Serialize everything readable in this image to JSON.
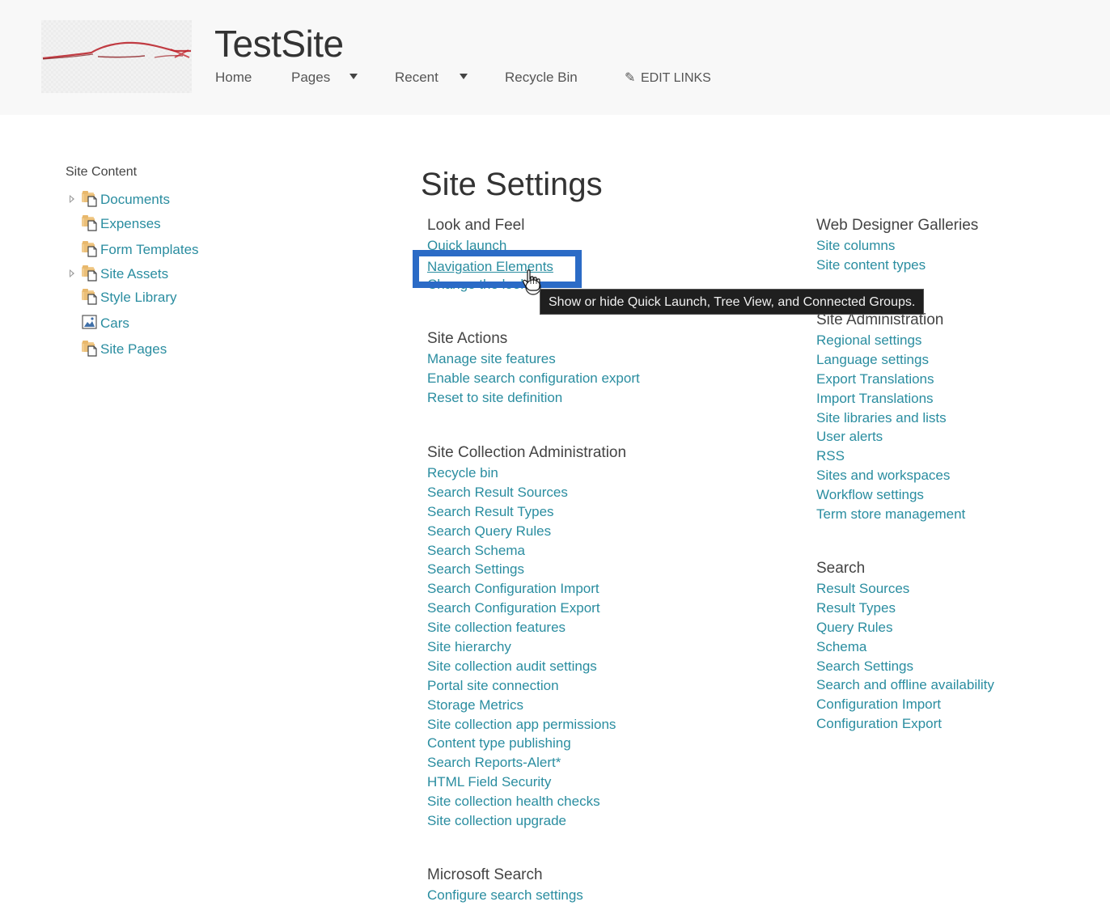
{
  "header": {
    "site_title": "TestSite",
    "logo": "car-silhouette-logo",
    "nav": [
      {
        "label": "Home",
        "has_dropdown": false
      },
      {
        "label": "Pages",
        "has_dropdown": true
      },
      {
        "label": "Recent",
        "has_dropdown": true
      },
      {
        "label": "Recycle Bin",
        "has_dropdown": false
      }
    ],
    "edit_links_label": "EDIT LINKS",
    "edit_links_icon": "pencil-icon"
  },
  "leftnav": {
    "title": "Site Content",
    "items": [
      {
        "label": "Documents",
        "icon": "document-library-icon",
        "expandable": true
      },
      {
        "label": "Expenses",
        "icon": "document-library-icon",
        "expandable": false
      },
      {
        "label": "Form Templates",
        "icon": "document-library-icon",
        "expandable": false
      },
      {
        "label": "Site Assets",
        "icon": "document-library-icon",
        "expandable": true
      },
      {
        "label": "Style Library",
        "icon": "document-library-icon",
        "expandable": false
      },
      {
        "label": "Cars",
        "icon": "picture-library-icon",
        "expandable": false
      },
      {
        "label": "Site Pages",
        "icon": "document-library-icon",
        "expandable": false
      }
    ]
  },
  "main": {
    "title": "Site Settings",
    "sections": {
      "look_and_feel": {
        "title": "Look and Feel",
        "links": [
          "Quick launch",
          "Navigation Elements",
          "Change the look"
        ]
      },
      "site_actions": {
        "title": "Site Actions",
        "links": [
          "Manage site features",
          "Enable search configuration export",
          "Reset to site definition"
        ]
      },
      "site_collection_admin": {
        "title": "Site Collection Administration",
        "links": [
          "Recycle bin",
          "Search Result Sources",
          "Search Result Types",
          "Search Query Rules",
          "Search Schema",
          "Search Settings",
          "Search Configuration Import",
          "Search Configuration Export",
          "Site collection features",
          "Site hierarchy",
          "Site collection audit settings",
          "Portal site connection",
          "Storage Metrics",
          "Site collection app permissions",
          "Content type publishing",
          "Search Reports-Alert*",
          "HTML Field Security",
          "Site collection health checks",
          "Site collection upgrade"
        ]
      },
      "microsoft_search": {
        "title": "Microsoft Search",
        "links": [
          "Configure search settings"
        ]
      },
      "web_designer_galleries": {
        "title": "Web Designer Galleries",
        "links": [
          "Site columns",
          "Site content types"
        ]
      },
      "site_administration": {
        "title": "Site Administration",
        "links": [
          "Regional settings",
          "Language settings",
          "Export Translations",
          "Import Translations",
          "Site libraries and lists",
          "User alerts",
          "RSS",
          "Sites and workspaces",
          "Workflow settings",
          "Term store management"
        ]
      },
      "search": {
        "title": "Search",
        "links": [
          "Result Sources",
          "Result Types",
          "Query Rules",
          "Schema",
          "Search Settings",
          "Search and offline availability",
          "Configuration Import",
          "Configuration Export"
        ]
      }
    },
    "hovered_link": "Navigation Elements",
    "tooltip": "Show or hide Quick Launch, Tree View, and Connected Groups."
  },
  "colors": {
    "link": "#2a8da0",
    "highlight": "#2b6bc6",
    "header_bg": "#f8f8f8",
    "tooltip_bg": "#1f1f1f"
  }
}
